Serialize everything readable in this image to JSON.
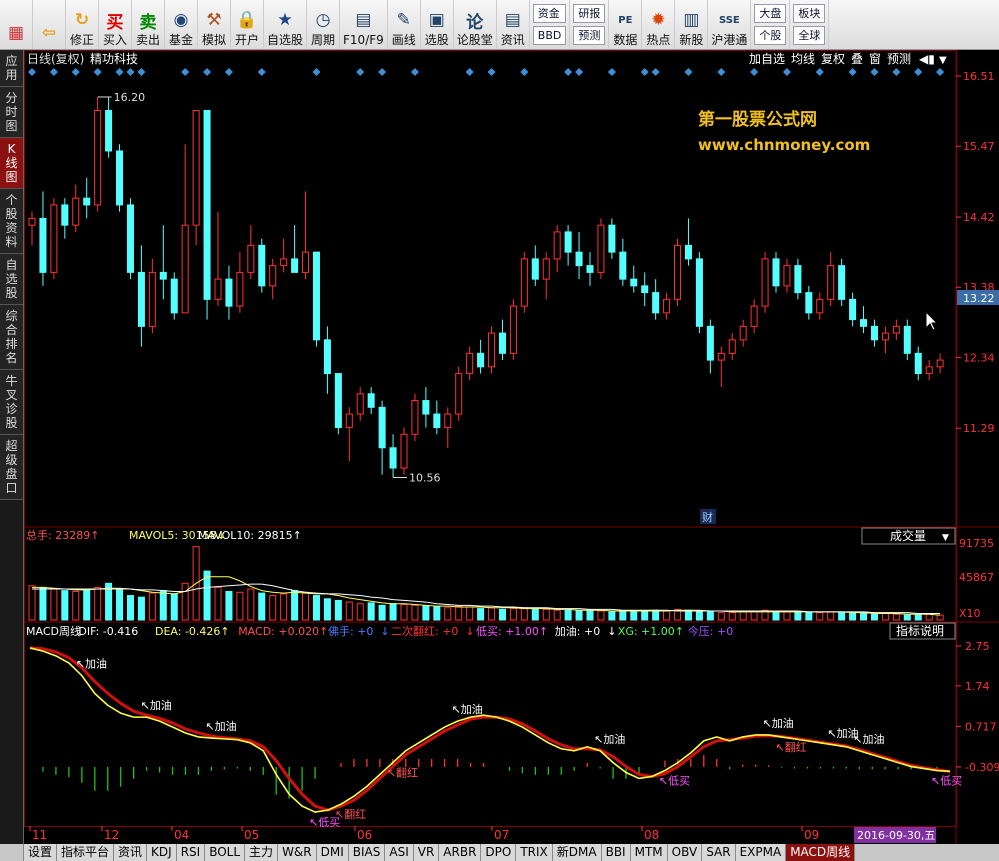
{
  "toolbar": {
    "buttons": [
      {
        "label": "",
        "icon": "grid-icon",
        "color": "#c33"
      },
      {
        "label": "",
        "icon": "back-arrow-icon",
        "color": "#e8a020"
      },
      {
        "label": "修正",
        "icon": "refresh-icon",
        "color": "#e8a020"
      },
      {
        "label": "买入",
        "icon": "buy-icon",
        "glyph": "买",
        "color": "#d00"
      },
      {
        "label": "卖出",
        "icon": "sell-icon",
        "glyph": "卖",
        "color": "#080"
      },
      {
        "label": "基金",
        "icon": "fund-icon",
        "color": "#247"
      },
      {
        "label": "模拟",
        "icon": "hammer-icon",
        "color": "#a52"
      },
      {
        "label": "开户",
        "icon": "lock-icon",
        "color": "#777"
      },
      {
        "label": "自选股",
        "icon": "star-window-icon",
        "color": "#248"
      },
      {
        "label": "周期",
        "icon": "clock-icon",
        "color": "#246"
      },
      {
        "label": "F10/F9",
        "icon": "f10-icon",
        "color": "#246"
      },
      {
        "label": "画线",
        "icon": "pen-icon",
        "color": "#246"
      },
      {
        "label": "选股",
        "icon": "screen-icon",
        "color": "#246"
      },
      {
        "label": "论股堂",
        "icon": "forum-icon",
        "glyph": "论",
        "color": "#246"
      },
      {
        "label": "资讯",
        "icon": "news-icon",
        "color": "#246"
      }
    ],
    "small_buttons": [
      [
        "资金",
        "BBD"
      ],
      [
        "研报",
        "预测"
      ]
    ],
    "buttons2": [
      {
        "label": "数据",
        "icon": "pe-icon",
        "glyph": "PE",
        "color": "#246"
      },
      {
        "label": "热点",
        "icon": "hot-icon",
        "color": "#d40"
      },
      {
        "label": "新股",
        "icon": "newstock-icon",
        "color": "#246"
      },
      {
        "label": "沪港通",
        "icon": "hk-icon",
        "glyph": "SSE",
        "color": "#246"
      }
    ],
    "small_buttons2": [
      [
        "大盘",
        "个股"
      ],
      [
        "板块",
        "全球"
      ]
    ]
  },
  "sidebar": {
    "items": [
      {
        "label": "应用",
        "active": false
      },
      {
        "label": "分时图",
        "active": false
      },
      {
        "label": "K线图",
        "active": true
      },
      {
        "label": "个股资料",
        "active": false
      },
      {
        "label": "自选股",
        "active": false
      },
      {
        "label": "综合排名",
        "active": false
      },
      {
        "label": "牛叉诊股",
        "active": false
      },
      {
        "label": "超级盘口",
        "active": false
      }
    ]
  },
  "chart_header": {
    "mode": "日线(复权)",
    "stock_name": "精功科技",
    "actions": [
      "加自选",
      "均线",
      "复权",
      "叠",
      "窗",
      "预测"
    ]
  },
  "watermark": {
    "line1": "第一股票公式网",
    "line2": "www.chnmoney.com"
  },
  "price_axis": {
    "ticks": [
      "16.51",
      "15.47",
      "14.42",
      "13.38",
      "12.34",
      "11.29"
    ],
    "current": "13.22"
  },
  "annotations": {
    "high": "16.20",
    "low": "10.56",
    "cai": "财"
  },
  "volume_header": {
    "total_label": "总手: 23289",
    "ma5_label": "MAVOL5: 30158",
    "ma10_label": "MAVOL10: 29815",
    "selector": "成交量"
  },
  "volume_axis": {
    "ticks": [
      "91735",
      "45867"
    ],
    "unit": "X10"
  },
  "macd_header": {
    "name": "MACD周线",
    "dif": "DIF: -0.416",
    "dea": "DEA: -0.426",
    "macd": "MACD: +0.020",
    "foshou": "佛手: +0",
    "erci": "二次翻红: +0",
    "dimai": "低买: +1.00",
    "jiayou": "加油: +0",
    "xg": "XG: +1.00",
    "jinya": "今压: +0",
    "explain": "指标说明"
  },
  "macd_axis": {
    "ticks": [
      "2.75",
      "1.74",
      "0.717",
      "-0.309"
    ]
  },
  "macd_labels": [
    "加油",
    "加油",
    "加油",
    "加油",
    "加油",
    "加油",
    "加油",
    "加油",
    "低买",
    "低买",
    "翻红",
    "翻红",
    "翻红",
    "低买"
  ],
  "time_axis": {
    "labels": [
      "11",
      "12",
      "04",
      "05",
      "06",
      "07",
      "08",
      "09"
    ],
    "current_date": "2016-09-30,五"
  },
  "bottom_tabs": [
    "设置",
    "指标平台",
    "资讯",
    "KDJ",
    "RSI",
    "BOLL",
    "主力",
    "W&R",
    "DMI",
    "BIAS",
    "ASI",
    "VR",
    "ARBR",
    "DPO",
    "TRIX",
    "新DMA",
    "BBI",
    "MTM",
    "OBV",
    "SAR",
    "EXPMA",
    "MACD周线"
  ],
  "active_bottom_tab": "MACD周线",
  "chart_data": [
    {
      "type": "candlestick",
      "title": "精功科技",
      "ylim": [
        10.3,
        16.6
      ],
      "yticks": [
        16.51,
        15.47,
        14.42,
        13.38,
        12.34,
        11.29
      ],
      "candles": [
        [
          14.3,
          14.5,
          14.0,
          14.4
        ],
        [
          14.4,
          14.8,
          13.4,
          13.6
        ],
        [
          13.6,
          14.7,
          13.5,
          14.6
        ],
        [
          14.6,
          14.7,
          14.1,
          14.3
        ],
        [
          14.3,
          14.9,
          14.2,
          14.7
        ],
        [
          14.7,
          15.0,
          14.4,
          14.6
        ],
        [
          14.6,
          16.2,
          14.5,
          16.0
        ],
        [
          16.0,
          16.2,
          15.3,
          15.4
        ],
        [
          15.4,
          15.5,
          14.5,
          14.6
        ],
        [
          14.6,
          14.7,
          13.5,
          13.6
        ],
        [
          13.6,
          14.0,
          12.5,
          12.8
        ],
        [
          12.8,
          13.8,
          12.7,
          13.6
        ],
        [
          13.6,
          14.3,
          13.2,
          13.5
        ],
        [
          13.5,
          13.6,
          12.9,
          13.0
        ],
        [
          13.0,
          15.5,
          13.0,
          14.3
        ],
        [
          14.3,
          16.0,
          14.0,
          16.0
        ],
        [
          16.0,
          16.0,
          12.9,
          13.2
        ],
        [
          13.2,
          14.5,
          13.1,
          13.5
        ],
        [
          13.5,
          13.7,
          12.9,
          13.1
        ],
        [
          13.1,
          13.9,
          13.0,
          13.6
        ],
        [
          13.6,
          14.3,
          13.5,
          14.0
        ],
        [
          14.0,
          14.1,
          13.3,
          13.4
        ],
        [
          13.4,
          13.8,
          13.2,
          13.7
        ],
        [
          13.7,
          14.1,
          13.6,
          13.8
        ],
        [
          13.8,
          14.3,
          13.7,
          13.6
        ],
        [
          13.6,
          14.8,
          13.5,
          13.9
        ],
        [
          13.9,
          13.9,
          12.5,
          12.6
        ],
        [
          12.6,
          12.8,
          11.8,
          12.1
        ],
        [
          12.1,
          12.1,
          11.2,
          11.3
        ],
        [
          11.3,
          11.6,
          10.8,
          11.5
        ],
        [
          11.5,
          11.9,
          11.4,
          11.8
        ],
        [
          11.8,
          11.9,
          11.5,
          11.6
        ],
        [
          11.6,
          11.7,
          10.6,
          11.0
        ],
        [
          11.0,
          11.2,
          10.56,
          10.7
        ],
        [
          10.7,
          11.3,
          10.6,
          11.2
        ],
        [
          11.2,
          11.8,
          11.1,
          11.7
        ],
        [
          11.7,
          11.9,
          11.3,
          11.5
        ],
        [
          11.5,
          11.7,
          11.2,
          11.3
        ],
        [
          11.3,
          11.6,
          11.0,
          11.5
        ],
        [
          11.5,
          12.2,
          11.4,
          12.1
        ],
        [
          12.1,
          12.5,
          12.0,
          12.4
        ],
        [
          12.4,
          12.6,
          12.1,
          12.2
        ],
        [
          12.2,
          12.8,
          12.1,
          12.7
        ],
        [
          12.7,
          12.9,
          12.3,
          12.4
        ],
        [
          12.4,
          13.2,
          12.3,
          13.1
        ],
        [
          13.1,
          13.9,
          13.0,
          13.8
        ],
        [
          13.8,
          14.0,
          13.4,
          13.5
        ],
        [
          13.5,
          13.9,
          13.2,
          13.8
        ],
        [
          13.8,
          14.3,
          13.6,
          14.2
        ],
        [
          14.2,
          14.3,
          13.7,
          13.9
        ],
        [
          13.9,
          14.2,
          13.5,
          13.7
        ],
        [
          13.7,
          13.9,
          13.4,
          13.6
        ],
        [
          13.6,
          14.4,
          13.5,
          14.3
        ],
        [
          14.3,
          14.4,
          13.8,
          13.9
        ],
        [
          13.9,
          14.1,
          13.4,
          13.5
        ],
        [
          13.5,
          13.7,
          13.3,
          13.4
        ],
        [
          13.4,
          13.6,
          13.1,
          13.3
        ],
        [
          13.3,
          13.5,
          12.9,
          13.0
        ],
        [
          13.0,
          13.3,
          12.9,
          13.2
        ],
        [
          13.2,
          14.1,
          13.1,
          14.0
        ],
        [
          14.0,
          14.4,
          13.7,
          13.8
        ],
        [
          13.8,
          13.9,
          12.7,
          12.8
        ],
        [
          12.8,
          12.9,
          12.1,
          12.3
        ],
        [
          12.3,
          12.5,
          11.9,
          12.4
        ],
        [
          12.4,
          12.7,
          12.3,
          12.6
        ],
        [
          12.6,
          12.9,
          12.5,
          12.8
        ],
        [
          12.8,
          13.2,
          12.7,
          13.1
        ],
        [
          13.1,
          13.9,
          13.0,
          13.8
        ],
        [
          13.8,
          13.9,
          13.3,
          13.4
        ],
        [
          13.4,
          13.8,
          13.3,
          13.7
        ],
        [
          13.7,
          13.8,
          13.2,
          13.3
        ],
        [
          13.3,
          13.4,
          12.9,
          13.0
        ],
        [
          13.0,
          13.3,
          12.9,
          13.2
        ],
        [
          13.2,
          13.9,
          13.1,
          13.7
        ],
        [
          13.7,
          13.8,
          13.1,
          13.2
        ],
        [
          13.2,
          13.3,
          12.8,
          12.9
        ],
        [
          12.9,
          13.1,
          12.7,
          12.8
        ],
        [
          12.8,
          12.9,
          12.5,
          12.6
        ],
        [
          12.6,
          12.8,
          12.4,
          12.7
        ],
        [
          12.7,
          12.9,
          12.6,
          12.8
        ],
        [
          12.8,
          12.9,
          12.3,
          12.4
        ],
        [
          12.4,
          12.5,
          12.0,
          12.1
        ],
        [
          12.1,
          12.3,
          12.0,
          12.2
        ],
        [
          12.2,
          12.4,
          12.1,
          12.3
        ]
      ]
    },
    {
      "type": "bar",
      "title": "成交量",
      "series": [
        {
          "name": "成交量",
          "values": [
            42,
            40,
            38,
            36,
            35,
            37,
            40,
            45,
            38,
            30,
            28,
            33,
            36,
            32,
            45,
            90,
            60,
            40,
            35,
            34,
            38,
            33,
            30,
            32,
            36,
            34,
            30,
            26,
            24,
            22,
            20,
            21,
            18,
            20,
            19,
            18,
            17,
            16,
            15,
            17,
            16,
            14,
            15,
            13,
            14,
            15,
            14,
            13,
            12,
            12,
            11,
            12,
            11,
            10,
            10,
            11,
            11,
            12,
            11,
            13,
            12,
            10,
            11,
            9,
            9,
            10,
            11,
            12,
            11,
            10,
            10,
            9,
            9,
            10,
            9,
            8,
            8,
            7,
            8,
            7,
            6,
            6,
            7,
            6,
            5
          ]
        },
        {
          "name": "MAVOL5",
          "values": [
            40,
            40,
            39,
            38,
            37,
            37,
            38,
            39,
            39,
            38,
            36,
            34,
            33,
            32,
            35,
            45,
            53,
            53,
            53,
            48,
            41,
            36,
            34,
            33,
            34,
            33,
            32,
            32,
            30,
            27,
            25,
            23,
            21,
            20,
            20,
            19,
            18,
            17,
            17,
            16,
            16,
            16,
            15,
            15,
            15,
            14,
            14,
            14,
            13,
            13,
            12,
            12,
            12,
            11,
            11,
            11,
            11,
            11,
            11,
            12,
            12,
            12,
            11,
            11,
            10,
            10,
            10,
            10,
            10,
            10,
            10,
            10,
            10,
            10,
            10,
            9,
            9,
            8,
            8,
            8,
            7,
            7,
            7,
            6,
            6
          ]
        },
        {
          "name": "MAVOL10",
          "values": [
            38,
            38,
            38,
            38,
            38,
            38,
            38,
            38,
            38,
            38,
            37,
            37,
            36,
            35,
            35,
            38,
            40,
            41,
            42,
            43,
            44,
            44,
            42,
            39,
            36,
            34,
            33,
            32,
            32,
            31,
            30,
            28,
            27,
            25,
            24,
            23,
            22,
            20,
            19,
            18,
            18,
            17,
            17,
            16,
            16,
            15,
            15,
            15,
            14,
            14,
            14,
            13,
            13,
            13,
            12,
            12,
            12,
            12,
            12,
            11,
            11,
            11,
            11,
            11,
            11,
            11,
            11,
            11,
            11,
            11,
            11,
            10,
            10,
            10,
            10,
            10,
            10,
            9,
            9,
            9,
            9,
            8,
            8,
            8,
            7
          ]
        }
      ],
      "yticks": [
        91735,
        45867
      ]
    },
    {
      "type": "line",
      "title": "MACD周线",
      "series": [
        {
          "name": "DIF",
          "values": [
            2.7,
            2.62,
            2.5,
            2.32,
            2.0,
            1.55,
            1.25,
            1.05,
            0.95,
            0.95,
            0.85,
            0.7,
            0.55,
            0.45,
            0.42,
            0.4,
            0.38,
            0.3,
            0.1,
            -0.5,
            -1.0,
            -1.3,
            -1.45,
            -1.4,
            -1.25,
            -1.05,
            -0.8,
            -0.5,
            -0.2,
            0.1,
            0.3,
            0.5,
            0.7,
            0.85,
            0.95,
            1.0,
            0.95,
            0.85,
            0.7,
            0.5,
            0.3,
            0.15,
            0.1,
            0.2,
            0.1,
            -0.2,
            -0.45,
            -0.6,
            -0.55,
            -0.4,
            -0.2,
            0.05,
            0.35,
            0.45,
            0.35,
            0.45,
            0.5,
            0.5,
            0.45,
            0.4,
            0.35,
            0.3,
            0.25,
            0.2,
            0.1,
            0.0,
            -0.1,
            -0.2,
            -0.3,
            -0.35,
            -0.4,
            -0.42
          ]
        },
        {
          "name": "DEA",
          "values": [
            2.7,
            2.68,
            2.6,
            2.45,
            2.2,
            1.85,
            1.55,
            1.3,
            1.1,
            1.0,
            0.92,
            0.8,
            0.65,
            0.55,
            0.47,
            0.43,
            0.4,
            0.35,
            0.2,
            -0.15,
            -0.6,
            -1.0,
            -1.3,
            -1.4,
            -1.3,
            -1.15,
            -0.9,
            -0.6,
            -0.3,
            0.0,
            0.2,
            0.4,
            0.6,
            0.75,
            0.9,
            0.95,
            0.95,
            0.9,
            0.78,
            0.6,
            0.4,
            0.25,
            0.15,
            0.15,
            0.12,
            -0.05,
            -0.3,
            -0.5,
            -0.55,
            -0.48,
            -0.3,
            -0.05,
            0.2,
            0.35,
            0.38,
            0.42,
            0.47,
            0.48,
            0.46,
            0.42,
            0.37,
            0.32,
            0.27,
            0.22,
            0.13,
            0.03,
            -0.07,
            -0.17,
            -0.27,
            -0.33,
            -0.38,
            -0.426
          ]
        }
      ],
      "yticks": [
        2.75,
        1.74,
        0.717,
        -0.309
      ]
    }
  ]
}
